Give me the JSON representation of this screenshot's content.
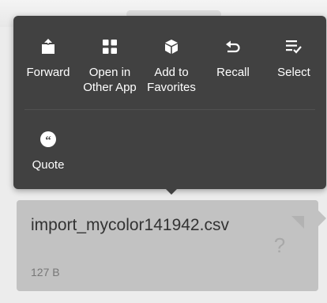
{
  "menu": {
    "items": [
      {
        "label_line1": "Forward",
        "label_line2": "",
        "icon": "share-icon"
      },
      {
        "label_line1": "Open in",
        "label_line2": "Other App",
        "icon": "apps-grid-icon"
      },
      {
        "label_line1": "Add to",
        "label_line2": "Favorites",
        "icon": "cube-icon"
      },
      {
        "label_line1": "Recall",
        "label_line2": "",
        "icon": "undo-icon"
      },
      {
        "label_line1": "Select",
        "label_line2": "",
        "icon": "checklist-icon"
      },
      {
        "label_line1": "Quote",
        "label_line2": "",
        "icon": "quote-icon"
      }
    ]
  },
  "file": {
    "name": "import_mycolor141942.csv",
    "size": "127 B",
    "type_icon_glyph": "?"
  },
  "colors": {
    "menu_bg": "#414141",
    "bubble_bg": "#c2c2c2",
    "text_primary": "#333333",
    "text_secondary": "#777777"
  }
}
